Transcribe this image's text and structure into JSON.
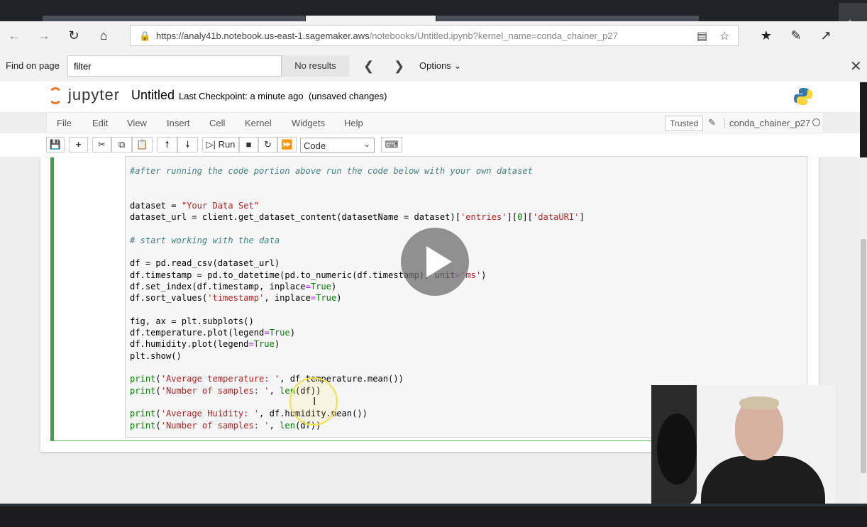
{
  "browser": {
    "url_host": "https://analy41b.notebook.us-east-1.sagemaker.aws",
    "url_path": "/notebooks/Untitled.ipynb?kernel_name=conda_chainer_p27",
    "back_icon": "arrow-left-icon",
    "forward_icon": "arrow-right-icon",
    "refresh_icon": "refresh-icon",
    "home_icon": "home-icon"
  },
  "findbar": {
    "label": "Find on page",
    "query": "filter",
    "results": "No results",
    "options_label": "Options"
  },
  "jupyter": {
    "logo_text": "jupyter",
    "notebook_name": "Untitled",
    "checkpoint": "Last Checkpoint: a minute ago",
    "unsaved": "(unsaved changes)",
    "accent_color": "#f37626"
  },
  "menu": {
    "items": [
      "File",
      "Edit",
      "View",
      "Insert",
      "Cell",
      "Kernel",
      "Widgets",
      "Help"
    ],
    "trusted": "Trusted",
    "kernel_name": "conda_chainer_p27"
  },
  "toolbar": {
    "run_label": "Run",
    "cell_type": "Code"
  },
  "cell": {
    "lines": [
      "#after running the code portion above run the code below with your own dataset",
      "",
      "",
      "dataset = \"Your Data Set\"",
      "dataset_url = client.get_dataset_content(datasetName = dataset)['entries'][0]['dataURI']",
      "",
      "# start working with the data",
      "",
      "df = pd.read_csv(dataset_url)",
      "df.timestamp = pd.to_datetime(pd.to_numeric(df.timestamp), unit='ms')",
      "df.set_index(df.timestamp, inplace=True)",
      "df.sort_values('timestamp', inplace=True)",
      "",
      "fig, ax = plt.subplots()",
      "df.temperature.plot(legend=True)",
      "df.humidity.plot(legend=True)",
      "plt.show()",
      "",
      "print('Average temperature: ', df.temperature.mean())",
      "print('Number of samples: ', len(df))",
      "",
      "print('Average Huidity: ', df.humidity.mean())",
      "print('Number of samples: ', len(df))"
    ]
  }
}
